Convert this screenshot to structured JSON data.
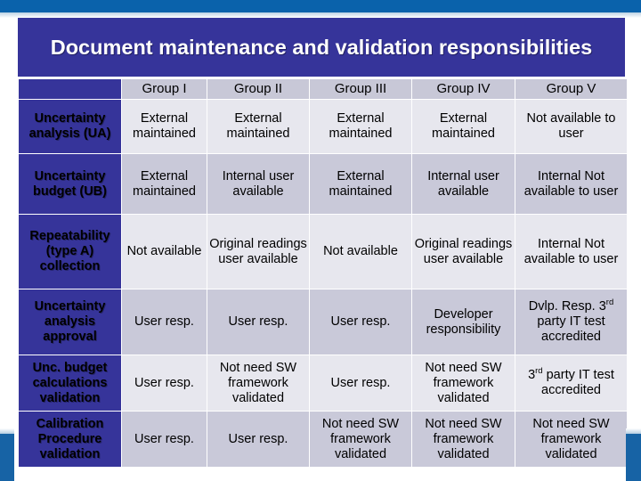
{
  "slide": {
    "title": "Document maintenance and validation responsibilities",
    "accent_blue": "#0a62ab",
    "navy": "#36349a",
    "band_light": "#e7e7ee",
    "band_dark": "#c9c9d9",
    "header_gray": "#c8c8d7"
  },
  "table": {
    "corner_label": "",
    "columns": [
      "",
      "Group I",
      "Group II",
      "Group III",
      "Group IV",
      "Group V"
    ],
    "rows": [
      {
        "label": "Uncertainty analysis (UA)",
        "cells": [
          "External maintained",
          "External maintained",
          "External maintained",
          "External maintained",
          "Not available to user"
        ]
      },
      {
        "label": "Uncertainty budget (UB)",
        "cells": [
          "External maintained",
          "Internal user available",
          "External maintained",
          "Internal user available",
          "Internal Not available to user"
        ]
      },
      {
        "label": "Repeatability (type A) collection",
        "cells": [
          "Not available",
          "Original readings user available",
          "Not available",
          "Original readings user available",
          "Internal Not available to user"
        ]
      },
      {
        "label": "Uncertainty analysis approval",
        "cells": [
          "User resp.",
          "User resp.",
          "User resp.",
          "Developer responsibility",
          "Dvlp. Resp. 3rd party IT test accredited"
        ]
      },
      {
        "label": "Unc. budget calculations validation",
        "cells": [
          "User resp.",
          "Not need SW framework validated",
          "User resp.",
          "Not need SW framework validated",
          "3rd party IT test accredited"
        ]
      },
      {
        "label": "Calibration Procedure validation",
        "cells": [
          "User resp.",
          "User resp.",
          "Not need SW framework validated",
          "Not need SW framework validated",
          "Not need SW framework validated"
        ]
      }
    ]
  }
}
